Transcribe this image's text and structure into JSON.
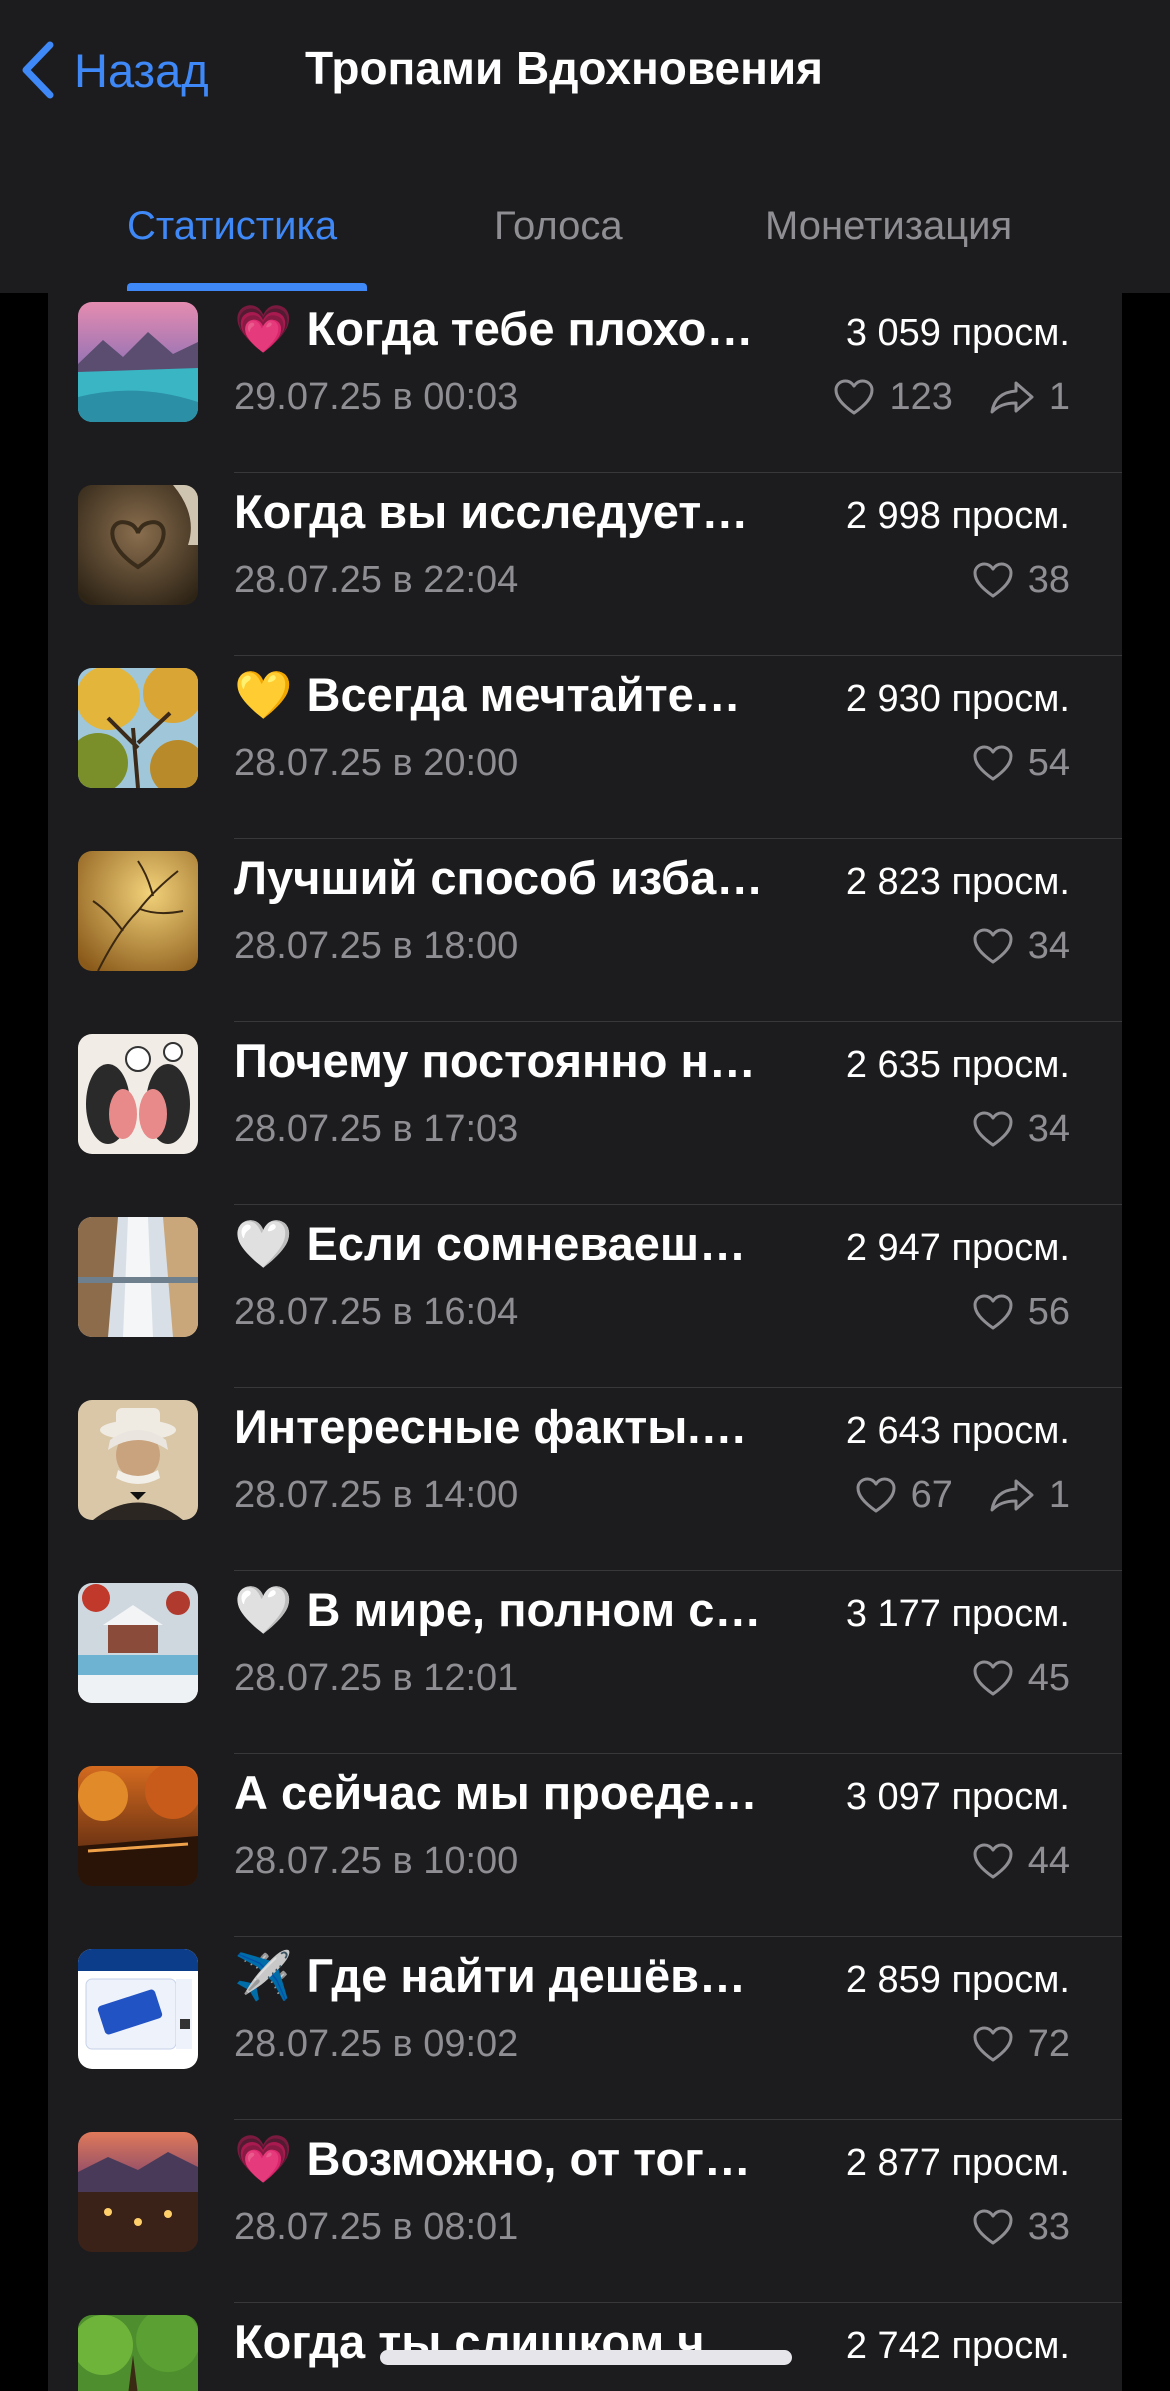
{
  "header": {
    "back_label": "Назад",
    "title": "Тропами Вдохновения"
  },
  "tabs": [
    {
      "label": "Статистика",
      "active": true
    },
    {
      "label": "Голоса",
      "active": false
    },
    {
      "label": "Монетизация",
      "active": false
    }
  ],
  "colors": {
    "accent": "#3e88f7",
    "background": "#000000",
    "surface": "#1c1c1e",
    "secondary_text": "#8e8e93"
  },
  "posts": [
    {
      "emoji": "💗",
      "title": "Когда тебе плохо…",
      "views": "3 059 просм.",
      "date": "29.07.25 в 00:03",
      "likes": "123",
      "shares": "1",
      "thumb": "mountain-lake"
    },
    {
      "emoji": "",
      "title": "Когда вы исследует…",
      "views": "2 998 просм.",
      "date": "28.07.25 в 22:04",
      "likes": "38",
      "shares": "",
      "thumb": "heart-in-sand"
    },
    {
      "emoji": "💛",
      "title": "Всегда мечтайте…",
      "views": "2 930 просм.",
      "date": "28.07.25 в 20:00",
      "likes": "54",
      "shares": "",
      "thumb": "autumn-trees"
    },
    {
      "emoji": "",
      "title": "Лучший способ изба…",
      "views": "2 823 просм.",
      "date": "28.07.25 в 18:00",
      "likes": "34",
      "shares": "",
      "thumb": "golden-branches"
    },
    {
      "emoji": "",
      "title": "Почему постоянно н…",
      "views": "2 635 просм.",
      "date": "28.07.25 в 17:03",
      "likes": "34",
      "shares": "",
      "thumb": "faces-illustration"
    },
    {
      "emoji": "🤍",
      "title": "Если сомневаеш…",
      "views": "2 947 просм.",
      "date": "28.07.25 в 16:04",
      "likes": "56",
      "shares": "",
      "thumb": "winter-road"
    },
    {
      "emoji": "",
      "title": "Интересные факты.…",
      "views": "2 643 просм.",
      "date": "28.07.25 в 14:00",
      "likes": "67",
      "shares": "1",
      "thumb": "portrait-photo"
    },
    {
      "emoji": "🤍",
      "title": "В мире, полном с…",
      "views": "3 177 просм.",
      "date": "28.07.25 в 12:01",
      "likes": "45",
      "shares": "",
      "thumb": "winter-house"
    },
    {
      "emoji": "",
      "title": "А сейчас мы проеде…",
      "views": "3 097 просм.",
      "date": "28.07.25 в 10:00",
      "likes": "44",
      "shares": "",
      "thumb": "autumn-street"
    },
    {
      "emoji": "✈️",
      "title": "Где найти дешёв…",
      "views": "2 859 просм.",
      "date": "28.07.25 в 09:02",
      "likes": "72",
      "shares": "",
      "thumb": "boarding-pass"
    },
    {
      "emoji": "💗",
      "title": "Возможно, от тог…",
      "views": "2 877 просм.",
      "date": "28.07.25 в 08:01",
      "likes": "33",
      "shares": "",
      "thumb": "evening-town"
    },
    {
      "emoji": "",
      "title": "Когда ты слишком ч…",
      "views": "2 742 просм.",
      "date": "",
      "likes": "",
      "shares": "",
      "thumb": "green-forest"
    }
  ]
}
